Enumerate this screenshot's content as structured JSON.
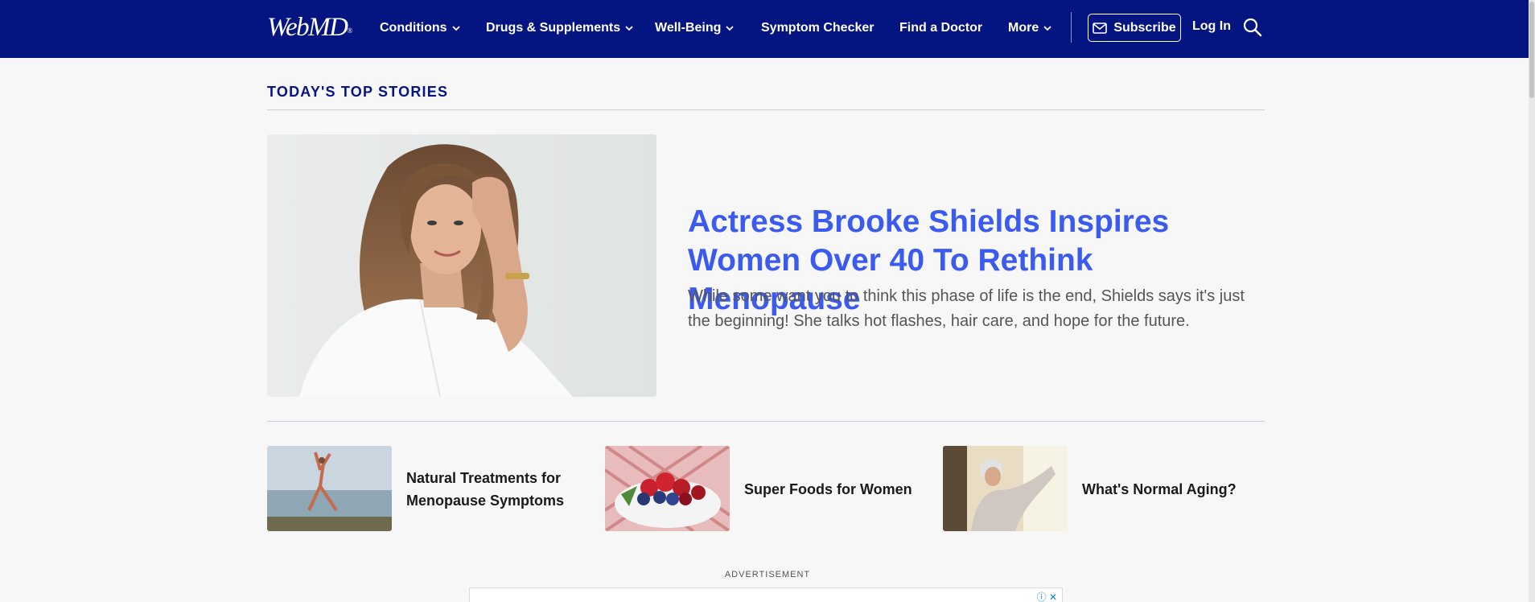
{
  "header": {
    "logo_text": "WebMD",
    "logo_mark": "®",
    "nav": [
      {
        "label": "Conditions",
        "dropdown": true
      },
      {
        "label": "Drugs & Supplements",
        "dropdown": true
      },
      {
        "label": "Well-Being",
        "dropdown": true
      },
      {
        "label": "Symptom Checker",
        "dropdown": false
      },
      {
        "label": "Find a Doctor",
        "dropdown": false
      },
      {
        "label": "More",
        "dropdown": true
      }
    ],
    "subscribe_label": "Subscribe",
    "login_label": "Log In",
    "search_icon": "search-icon",
    "bg_color": "#041480"
  },
  "top_stories": {
    "heading": "TODAY'S TOP STORIES",
    "hero": {
      "title": "Actress Brooke Shields Inspires Women Over 40 To Rethink Menopause",
      "description": "While some want you to think this phase of life is the end, Shields says it's just the beginning! She talks hot flashes, hair care, and hope for the future.",
      "title_color": "#3b5bf0"
    },
    "cards": [
      {
        "title": "Natural Treatments for Menopause Symptoms"
      },
      {
        "title": "Super Foods for Women"
      },
      {
        "title": "What's Normal Aging?"
      }
    ]
  },
  "advertisement": {
    "label": "ADVERTISEMENT"
  }
}
